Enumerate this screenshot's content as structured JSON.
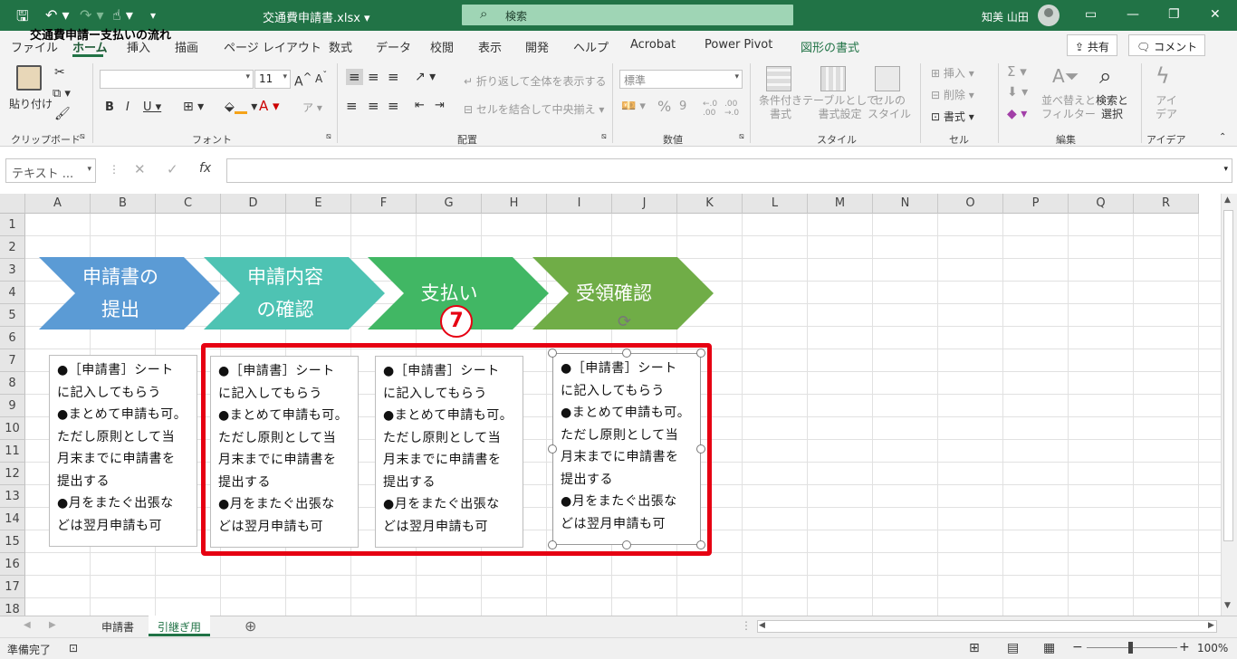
{
  "window": {
    "doc_title": "交通費申請書.xlsx ▾",
    "search_label": "検索",
    "user_name": "知美 山田"
  },
  "menu": {
    "tabs": [
      "ファイル",
      "ホーム",
      "挿入",
      "描画",
      "ページ レイアウト",
      "数式",
      "データ",
      "校閲",
      "表示",
      "開発",
      "ヘルプ",
      "Acrobat",
      "Power Pivot",
      "図形の書式"
    ],
    "share": "共有",
    "comment": "コメント"
  },
  "ribbon": {
    "paste": "貼り付け",
    "font_size": "11",
    "wrap_text": "折り返して全体を表示する",
    "merge_center": "セルを結合して中央揃え",
    "number_format": "標準",
    "cond_format": "条件付き\n書式",
    "table_format": "テーブルとして\n書式設定",
    "cell_style": "セルの\nスタイル",
    "insert": "挿入",
    "delete": "削除",
    "format": "書式",
    "sort_filter": "並べ替えと\nフィルター",
    "find_select": "検索と\n選択",
    "ideas": "アイ\nデア",
    "groups": [
      "クリップボード",
      "フォント",
      "配置",
      "数値",
      "スタイル",
      "セル",
      "編集",
      "アイデア"
    ]
  },
  "formula_bar": {
    "name_box": "テキスト ..."
  },
  "sheet": {
    "columns": [
      "A",
      "B",
      "C",
      "D",
      "E",
      "F",
      "G",
      "H",
      "I",
      "J",
      "K",
      "L",
      "M",
      "N",
      "O",
      "P",
      "Q",
      "R"
    ],
    "rows": [
      "1",
      "2",
      "3",
      "4",
      "5",
      "6",
      "7",
      "8",
      "9",
      "10",
      "11",
      "12",
      "13",
      "14",
      "15",
      "16",
      "17",
      "18"
    ],
    "a1": "交通費申請ー支払いの流れ",
    "arrows": [
      {
        "label": "申請書の\n提出",
        "color": "#5b9bd5"
      },
      {
        "label": "申請内容\nの確認",
        "color": "#4ec3b3"
      },
      {
        "label": "支払い",
        "color": "#41b764"
      },
      {
        "label": "受領確認",
        "color": "#70ad47"
      }
    ],
    "textbox_text": "●［申請書］シート\nに記入してもらう\n●まとめて申請も可。\nただし原則として当\n月末までに申請書を\n提出する\n●月をまたぐ出張な\nどは翌月申請も可",
    "step_badge": "7",
    "highlight_color": "#e60012"
  },
  "sheet_tabs": [
    "申請書",
    "引継ぎ用"
  ],
  "status": {
    "ready": "準備完了",
    "zoom": "100%"
  }
}
